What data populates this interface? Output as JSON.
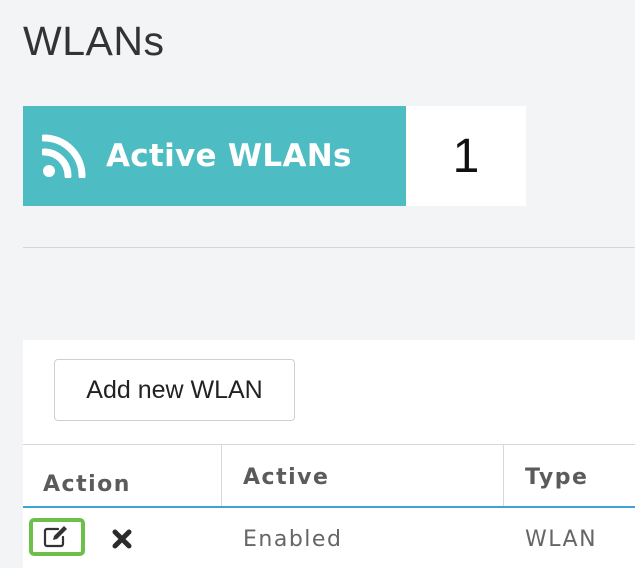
{
  "page": {
    "title": "WLANs"
  },
  "summary": {
    "label": "Active WLANs",
    "count": "1",
    "icon": "rss-icon",
    "accent_color": "#4ebcc3"
  },
  "toolbar": {
    "add_label": "Add new WLAN"
  },
  "table": {
    "columns": [
      "Action",
      "Active",
      "Type"
    ],
    "header_line_color": "#3ea3cf",
    "rows": [
      {
        "actions": [
          {
            "icon": "edit-icon",
            "highlight_color": "#6cc04a"
          },
          {
            "icon": "close-icon"
          }
        ],
        "active": "Enabled",
        "type": "WLAN"
      }
    ]
  }
}
